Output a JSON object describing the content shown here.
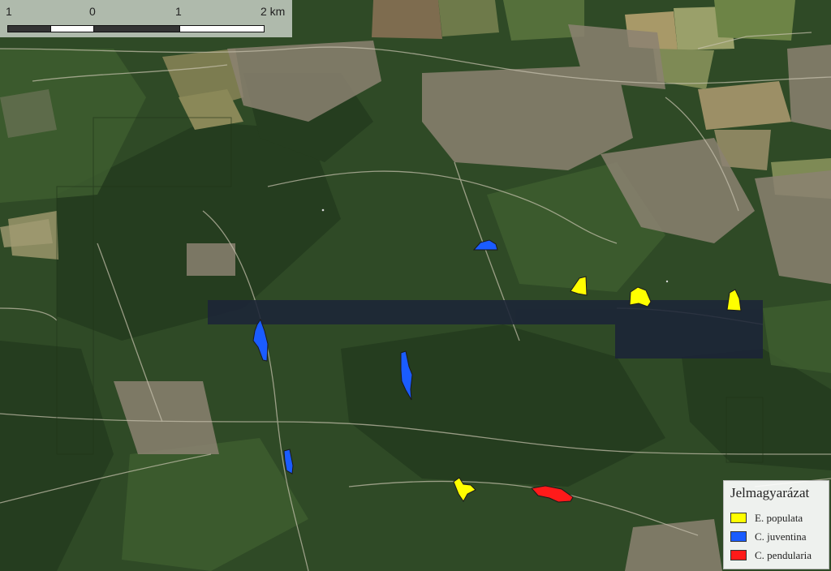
{
  "scale_bar": {
    "labels": [
      "1",
      "0",
      "1",
      "2 km"
    ],
    "colors": {
      "dark": "#333333",
      "light": "#ffffff"
    }
  },
  "legend": {
    "title": "Jelmagyarázat",
    "items": [
      {
        "label": "E. populata",
        "color": "#ffff00"
      },
      {
        "label": "C. juventina",
        "color": "#1a5cff"
      },
      {
        "label": "C. pendularia",
        "color": "#ff1a1a"
      }
    ]
  },
  "colors": {
    "forest": "#2f4a26",
    "forest_dark": "#253d1f",
    "field": "#8a8a5a",
    "urban": "#8c8272",
    "cloud_band": "#1c2438",
    "road": "#c9c3b0"
  }
}
